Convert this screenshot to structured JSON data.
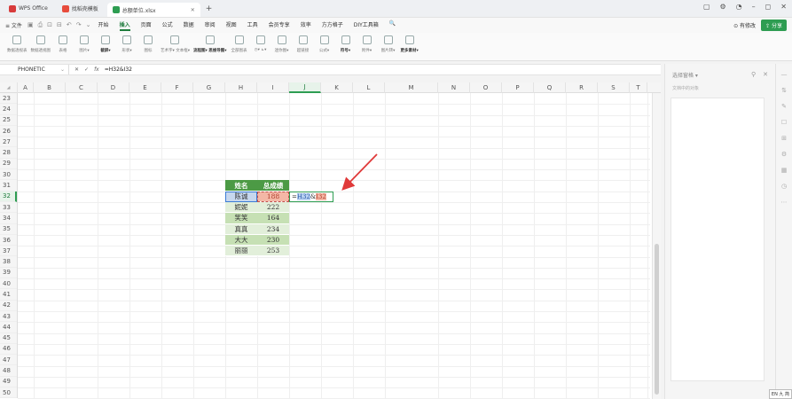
{
  "titlebar": {
    "tabs": [
      {
        "label": "WPS Office",
        "color": "#d83b3b"
      },
      {
        "label": "找稻壳模板",
        "color": "#e74c3c"
      },
      {
        "label": "总额单位.xlsx",
        "color": "#2e9d52"
      }
    ],
    "plus": "+",
    "win_controls": [
      "▢",
      "⚙",
      "◔",
      "–",
      "◻",
      "✕"
    ]
  },
  "menubar": {
    "file_label": "≡ 文件",
    "quick_icons": [
      "▣",
      "⎙",
      "⊡",
      "⊟",
      "↶",
      "↷",
      "⌄"
    ],
    "menus": [
      "开始",
      "插入",
      "页面",
      "公式",
      "数据",
      "审阅",
      "视图",
      "工具",
      "会员专享",
      "效率",
      "方方格子",
      "DIY工具箱",
      "🔍"
    ],
    "active_menu": "插入",
    "collab_label": "⊙ 有修改",
    "share_label": "⇪ 分享"
  },
  "ribbon": {
    "groups": [
      {
        "label": "数据透视表"
      },
      {
        "label": "数据透视图"
      },
      {
        "label": "表格"
      },
      {
        "label": "图片▾"
      },
      {
        "label": "截屏▾",
        "dark": true
      },
      {
        "label": "形状▾"
      },
      {
        "label": "图标"
      },
      {
        "label": "艺术字▾ 文本框▾"
      },
      {
        "label": "流程图▾ 思维导图▾",
        "dark": true
      },
      {
        "label": "全部图表"
      },
      {
        "label": "◷▾ ⊾▾"
      },
      {
        "label": "迷你图▾"
      },
      {
        "label": "超链接"
      },
      {
        "label": "公式▾"
      },
      {
        "label": "符号▾",
        "dark": true
      },
      {
        "label": "附件▾"
      },
      {
        "label": "图片转▾"
      },
      {
        "label": "更多素材▾",
        "dark": true
      }
    ]
  },
  "formulabar": {
    "namebox": "PHONETIC",
    "cancel": "✕",
    "confirm": "✓",
    "fx": "fx",
    "formula": "=H32&I32"
  },
  "grid": {
    "columns": [
      "A",
      "B",
      "C",
      "D",
      "E",
      "F",
      "G",
      "H",
      "I",
      "J",
      "K",
      "L",
      "M",
      "N",
      "O",
      "P",
      "Q",
      "R",
      "S",
      "T"
    ],
    "selected_column": "J",
    "rows": [
      "23",
      "24",
      "25",
      "26",
      "27",
      "28",
      "29",
      "30",
      "31",
      "32",
      "33",
      "34",
      "35",
      "36",
      "37",
      "38",
      "39",
      "40",
      "41",
      "42",
      "43",
      "44",
      "45",
      "46",
      "47",
      "48",
      "49",
      "50"
    ],
    "selected_row": "32",
    "table": {
      "headers": [
        "姓名",
        "总成绩"
      ],
      "rows": [
        {
          "name": "陈诚",
          "score": "188"
        },
        {
          "name": "妮妮",
          "score": "222"
        },
        {
          "name": "笑笑",
          "score": "164"
        },
        {
          "name": "真真",
          "score": "234"
        },
        {
          "name": "大大",
          "score": "230"
        },
        {
          "name": "丽丽",
          "score": "253"
        }
      ]
    },
    "editing_cell": {
      "prefix": "=",
      "ref1": "H32",
      "op": "&",
      "ref2": "I32"
    },
    "corner": "◢"
  },
  "sidepanel": {
    "title": "选择窗格 ▾",
    "controls": [
      "⚲",
      "✕"
    ],
    "subtitle": "文档中的对象"
  },
  "righttools": [
    "—",
    "⇅",
    "✎",
    "☐",
    "⊞",
    "⚙",
    "▦",
    "◷",
    "⋯"
  ],
  "ime": "EN 九 简"
}
